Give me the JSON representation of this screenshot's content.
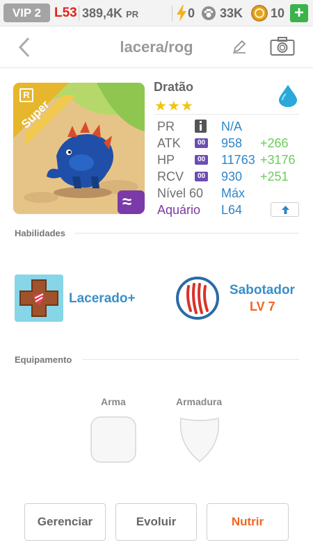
{
  "statusbar": {
    "vip": "VIP 2",
    "level": "L53",
    "power": "389,4K",
    "power_unit": "PR",
    "energy": "0",
    "food": "33K",
    "coins": "10",
    "add_label": "+"
  },
  "header": {
    "title": "lacera/rog"
  },
  "monster": {
    "name": "Dratão",
    "stars": "★★★",
    "rank_badge": "R",
    "ribbon": "Super",
    "element_mark": "≈",
    "stats": {
      "pr_label": "PR",
      "pr_value": "N/A",
      "atk_label": "ATK",
      "atk_value": "958",
      "atk_bonus": "+266",
      "hp_label": "HP",
      "hp_value": "11763",
      "hp_bonus": "+3176",
      "rcv_label": "RCV",
      "rcv_value": "930",
      "rcv_bonus": "+251",
      "level_label": "Nível 60",
      "level_value": "Máx",
      "habitat_label": "Aquário",
      "habitat_value": "L64",
      "badge_text": "00"
    }
  },
  "abilities": {
    "section_label": "Habilidades",
    "skill1_name": "Lacerado+",
    "skill2_name": "Sabotador",
    "skill2_level": "LV 7"
  },
  "equipment": {
    "section_label": "Equipamento",
    "weapon_label": "Arma",
    "armor_label": "Armadura"
  },
  "actions": {
    "manage": "Gerenciar",
    "evolve": "Evoluir",
    "feed": "Nutrir"
  },
  "colors": {
    "accent_blue": "#2e86c9",
    "bonus_green": "#6ccc5b",
    "level_red": "#e2231a",
    "habitat_purple": "#7b3aa0",
    "feed_orange": "#f26522"
  }
}
